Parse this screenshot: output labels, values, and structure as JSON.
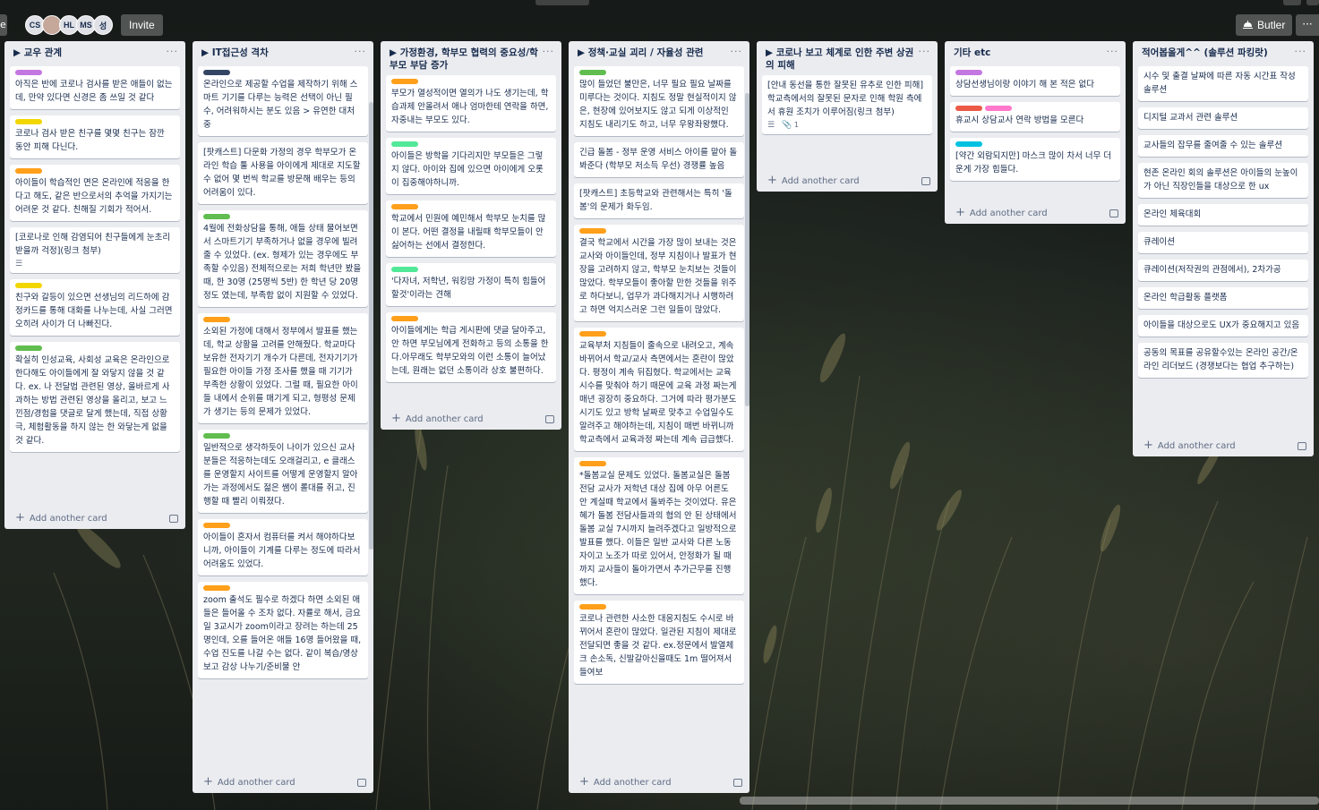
{
  "header": {
    "left_stub": "e",
    "avatars": [
      "CS",
      "",
      "HL",
      "MS",
      "성"
    ],
    "invite_label": "Invite",
    "butler_label": "Butler",
    "menu_label": "···"
  },
  "colors": {
    "purple": "#c377e0",
    "yellow": "#f2d600",
    "orange": "#ff9f1a",
    "green": "#61bd4f",
    "navy": "#344563",
    "red": "#eb5a46",
    "pink": "#ff78cb",
    "sky": "#00c2e0",
    "mint": "#51e898"
  },
  "common": {
    "add_card": "Add another card",
    "list_menu": "···"
  },
  "lists": [
    {
      "title": "▶ 교우 관계",
      "cards": [
        {
          "labels": [
            "purple"
          ],
          "text": "아직은 반에 코로나 검사를 받은 애들이 없는데, 만약 있다면 신경은 좀 쓰일 것 같다"
        },
        {
          "labels": [
            "yellow"
          ],
          "text": "코로나 검사 받은 친구를 몇몇 친구는 잠깐 동안 피해 다닌다."
        },
        {
          "labels": [
            "orange"
          ],
          "text": "아이들이 학습적인 면은 온라인에 적응을 한다고 해도, 같은 반으로서의 추억을 가지기는 어려운 것 같다. 친해질 기회가 적어서."
        },
        {
          "labels": [],
          "text": "[코로나로 인해 감염되어 친구들에게 눈초리 받을까 걱정](링크 첨부)",
          "badges": [
            "desc"
          ]
        },
        {
          "labels": [
            "yellow"
          ],
          "text": "친구와 갈등이 있으면 선생님의 리드하에 감정카드를 통해 대화를 나누는데, 사실 그러면 오히려 사이가 더 나빠진다."
        },
        {
          "labels": [
            "green"
          ],
          "text": "확실히 인성교육, 사회성 교육은 온라인으로 한다해도 아이들에게 잘 와닿지 않을 것 같다. ex. 나 전달법 관련된 영상, 올바르게 사과하는 방법 관련된 영상을 올리고, 보고 느낀점/경험을 댓글로 달게 했는데, 직접 상황극, 체험활동을 하지 않는 한 와닿는게 없을 것 같다."
        }
      ]
    },
    {
      "title": "▶ IT접근성 격차",
      "cards": [
        {
          "labels": [
            "navy"
          ],
          "text": "온라인으로 제공할 수업을 제작하기 위해 스마트 기기를 다루는 능력은 선택이 아닌 필수, 어려워하시는 분도 있음 > 유연한 대처 중"
        },
        {
          "labels": [],
          "text": "[팟캐스트] 다문화 가정의 경우 학부모가 온라인 학습 툴 사용을 아이에게 제대로 지도할 수 없어 몇 번씩 학교를 방문해 배우는 등의 어려움이 있다."
        },
        {
          "labels": [
            "green"
          ],
          "text": "4월에 전화상담을 통해, 애들 상태 물어보면서 스마트기기 부족하거나 없을 경우에 빌려줄 수 있었다. (ex. 형제가 있는 경우에도 부족할 수있음) 전체적으로는 저희 학년만 봤을 때, 한 30명 (25명씩 5반) 한 학년 당 20명정도 였는데, 부족함 없이 지원할 수 있었다."
        },
        {
          "labels": [
            "orange"
          ],
          "text": "소외된 가정에 대해서 정부에서 발표를 했는데, 학교 상황을 고려를 안해줬다. 학교마다 보유한 전자기기 개수가 다른데, 전자기기가 필요한 아이들 가정 조사를 했을 때 기기가 부족한 상황이 있었다. 그럴 때, 필요한 아이들 내에서 순위를 매기게 되고, 형평성 문제가 생기는 등의 문제가 있었다."
        },
        {
          "labels": [
            "green"
          ],
          "text": "일반적으로 생각하듯이 나이가 있으신 교사 분들은 적응하는데도 오래걸리고, e 클래스를 운영할지 사이트를 어떻게 운영할지 알아가는 과정에서도 젊은 쌤이 롤대를 쥐고, 진행할 때 빨리 이뤄졌다."
        },
        {
          "labels": [
            "orange"
          ],
          "text": "아이들이 혼자서 컴퓨터를 켜서 해야하다보니까, 아이들이 기계를 다루는 정도에 따라서 어려움도 있었다."
        },
        {
          "labels": [
            "orange"
          ],
          "text": "zoom 출석도 필수로 하겠다 하면 소외된 애들은 들어올 수 조차 없다. 자률로 해서, 금요일 3교시가 zoom이라고 장려는 하는데 25명인데, 오를 들어온 애들 16명 들어왔을 때, 수업 진도를 나갈 수는 없다. 같이 복습/영상 보고 감상 나누기/준비물 안"
        }
      ]
    },
    {
      "title": "▶ 가정환경, 학부모 협력의 중요성/학부모 부담 증가",
      "cards": [
        {
          "labels": [
            "orange"
          ],
          "text": "부모가 열성적이면 열의가 나도 생기는데, 학습과제 안올려서 애나 엄마한테 연락을 하면, 자중내는 부모도 있다."
        },
        {
          "labels": [
            "mint"
          ],
          "text": "아이들은 방학을 기다리지만 부모들은 그렇지 않다. 아이와 집에 있으면 아이에게 오롯이 집중해야하니까."
        },
        {
          "labels": [
            "orange"
          ],
          "text": "학교에서 민원에 예민해서 학부모 눈치를 많이 본다. 어떤 결정을 내릴때 학부모들이 안 싫어하는 선에서 결정한다."
        },
        {
          "labels": [
            "mint"
          ],
          "text": "'다자녀, 저학년, 워킹맘 가정이 특히 힘들어할것'이라는 견해"
        },
        {
          "labels": [
            "orange"
          ],
          "text": "아이들에게는 학급 게시판에 댓글 달아주고, 안 하면 부모님에게 전화하고 등의 소통을 한다.아무래도 학부모와의 이런 소통이 늘어났는데, 원래는 없던 소통이라 상호 불편하다."
        }
      ]
    },
    {
      "title": "▶ 정책·교실 괴리 / 자율성 관련",
      "cards": [
        {
          "labels": [
            "green"
          ],
          "text": "많이 들었던 불만은, 너무 필요 필요 날짜를 미루다는 것이다. 지침도 정말 현실적이지 않은, 현장에 있어보지도 않고 되게 이상적인 지침도 내리기도 하고, 너무 우왕좌왕했다."
        },
        {
          "labels": [],
          "text": "긴급 돌봄 - 정부 운영 서비스 아이를 맡아 돌봐준다 (학부모 저소득 우선) 경쟁률 높음"
        },
        {
          "labels": [],
          "text": "[팟캐스트] 초등학교와 관련해서는 특히 '돌봄'의 문제가 화두임."
        },
        {
          "labels": [
            "orange"
          ],
          "text": "결국 학교에서 시간을 가장 많이 보내는 것은 교사와 아이들인데, 정부 지침이나 발표가 현장을 고려하지 않고, 학부모 눈치보는 것들이 많았다. 학부모들이 좋아할 만한 것들을 위주로 하다보니, 업무가 과다해지거나 시행하려고 하면 억지스러운 그런 일들이 많았다."
        },
        {
          "labels": [
            "orange"
          ],
          "text": "교육부처 지침들이 줄속으로 내려오고, 계속 바뀌어서 학교/교사 측면에서는 혼란이 많았다. 평정이 계속 뒤집혔다. 학교에서는 교육시수를 맞춰야 하기 때문에 교육 과정 짜는게 매년 굉장히 중요하다. 그거에 따라 평가분도 시기도 있고 방학 날짜로 맞추고 수업일수도 알려주고 해야하는데, 지침이 매번 바뀌니까 학교측에서 교육과정 짜는데 계속 급급했다."
        },
        {
          "labels": [
            "orange"
          ],
          "text": "*돌봄교실 문제도 있었다. 돌봄교실은 돌봄 전담 교사가 저학년 대상 집에 아무 어른도 안 계실때 학교에서 돌봐주는 것이었다. 유은혜가 돌봄 전담사들과의 협의 안 된 상태에서 돌봄 교실 7시까지 늘려주겠다고 일방적으로 발표를 했다. 이들은 일반 교사와 다른 노동자이고 노조가 따로 있어서, 안정화가 될 때까지 교사들이 돌아가면서 추가근무를 진행했다."
        },
        {
          "labels": [
            "orange"
          ],
          "text": "코로나 관련한 사소한 대응지침도 수시로 바뀌어서 혼란이 많았다. 일관된 지침이 제대로 전달되면 좋을 것 같다. ex.정문에서 발열체크 손소독, 신발갈아신을때도 1m 떨어져서 들여보"
        }
      ]
    },
    {
      "title": "▶ 코로나 보고 체계로 인한 주변 상권의 피해",
      "cards": [
        {
          "labels": [],
          "text": "[안내 동선을 통한 잘못된 유추로 인한 피해] 학교측에서의 잘못된 문자로 인해 학원 측에서 휴원 조치가 이루어짐(링크 첨부)",
          "badges": [
            "desc",
            "attach"
          ],
          "attach_count": "1"
        }
      ]
    },
    {
      "title": "기타 etc",
      "cards": [
        {
          "labels": [
            "purple"
          ],
          "text": "상담선생님이랑 이야기 해 본 적은 없다"
        },
        {
          "labels": [
            "red",
            "pink"
          ],
          "text": "휴교시 상담교사 연락 방법을 모른다"
        },
        {
          "labels": [
            "sky"
          ],
          "text": "[약간 외람되지만] 마스크 많이 차서 너무 더운게 가장 힘들다."
        }
      ]
    },
    {
      "title": "적어봅올게^^ (솔루션 파킹랏)",
      "cards": [
        {
          "labels": [],
          "text": "시수 및 출결 날짜에 따른 자동 시간표 작성 솔루션"
        },
        {
          "labels": [],
          "text": "디지털 교과서 관련 솔루션"
        },
        {
          "labels": [],
          "text": "교사들의 잡무를 줄여줄 수 있는 솔루션"
        },
        {
          "labels": [],
          "text": "현존 온라인 회의 솔루션은 아이들의 눈높이가 아닌 직장인들을 대상으로 한 ux"
        },
        {
          "labels": [],
          "text": "온라인 체육대회"
        },
        {
          "labels": [],
          "text": "큐레이션"
        },
        {
          "labels": [],
          "text": "큐레이션(저작권의 관점에서), 2차가공"
        },
        {
          "labels": [],
          "text": "온라인 학급활동 플랫폼"
        },
        {
          "labels": [],
          "text": "아이들을 대상으로도 UX가 중요해지고 있음"
        },
        {
          "labels": [],
          "text": "공동의 목표를 공유할수있는 온라인 공간/온라인 리더보드 (경쟁보다는 협업 추구하는)"
        }
      ]
    }
  ]
}
